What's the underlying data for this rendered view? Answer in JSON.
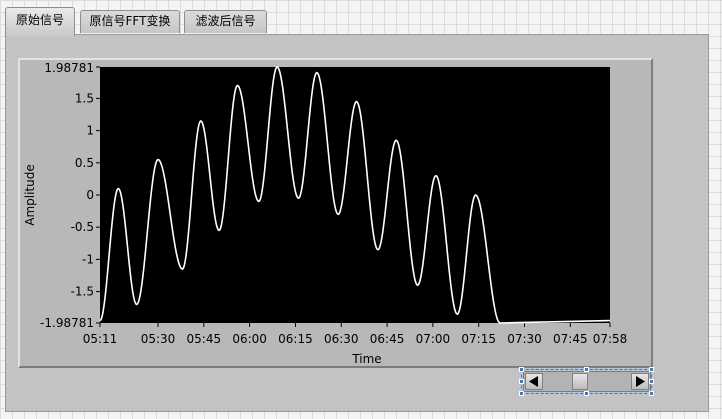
{
  "tabs": [
    {
      "label": "原始信号",
      "active": true
    },
    {
      "label": "原信号FFT变换",
      "active": false
    },
    {
      "label": "滤波后信号",
      "active": false
    }
  ],
  "chart_data": {
    "type": "line",
    "xlabel": "Time",
    "ylabel": "Amplitude",
    "x_tick_labels": [
      "05:11",
      "05:30",
      "05:45",
      "06:00",
      "06:15",
      "06:30",
      "06:45",
      "07:00",
      "07:15",
      "07:30",
      "07:45",
      "07:58"
    ],
    "y_tick_labels": [
      "1.98781",
      "1.5",
      "1",
      "0.5",
      "0",
      "-0.5",
      "-1",
      "-1.5",
      "-1.98781"
    ],
    "ylim": [
      -1.98781,
      1.98781
    ],
    "xlim": [
      "05:11",
      "07:58"
    ],
    "background": "#000000",
    "line_color": "#ffffff",
    "grid": false,
    "legend": "none",
    "series": [
      {
        "description_values": [
          [
            "05:11",
            -1.95
          ],
          [
            "05:17",
            0.1
          ],
          [
            "05:23",
            -1.7
          ],
          [
            "05:30",
            0.55
          ],
          [
            "05:38",
            -1.15
          ],
          [
            "05:44",
            1.15
          ],
          [
            "05:50",
            -0.55
          ],
          [
            "05:56",
            1.7
          ],
          [
            "06:03",
            -0.1
          ],
          [
            "06:09",
            1.98781
          ],
          [
            "06:16",
            -0.05
          ],
          [
            "06:22",
            1.9
          ],
          [
            "06:29",
            -0.3
          ],
          [
            "06:35",
            1.45
          ],
          [
            "06:42",
            -0.85
          ],
          [
            "06:48",
            0.85
          ],
          [
            "06:55",
            -1.4
          ],
          [
            "07:01",
            0.3
          ],
          [
            "07:08",
            -1.85
          ],
          [
            "07:14",
            0.0
          ],
          [
            "07:22",
            -1.98781
          ]
        ]
      }
    ]
  },
  "scrollbar": {
    "left_arrow_icon": "triangle-left-icon",
    "right_arrow_icon": "triangle-right-icon"
  }
}
